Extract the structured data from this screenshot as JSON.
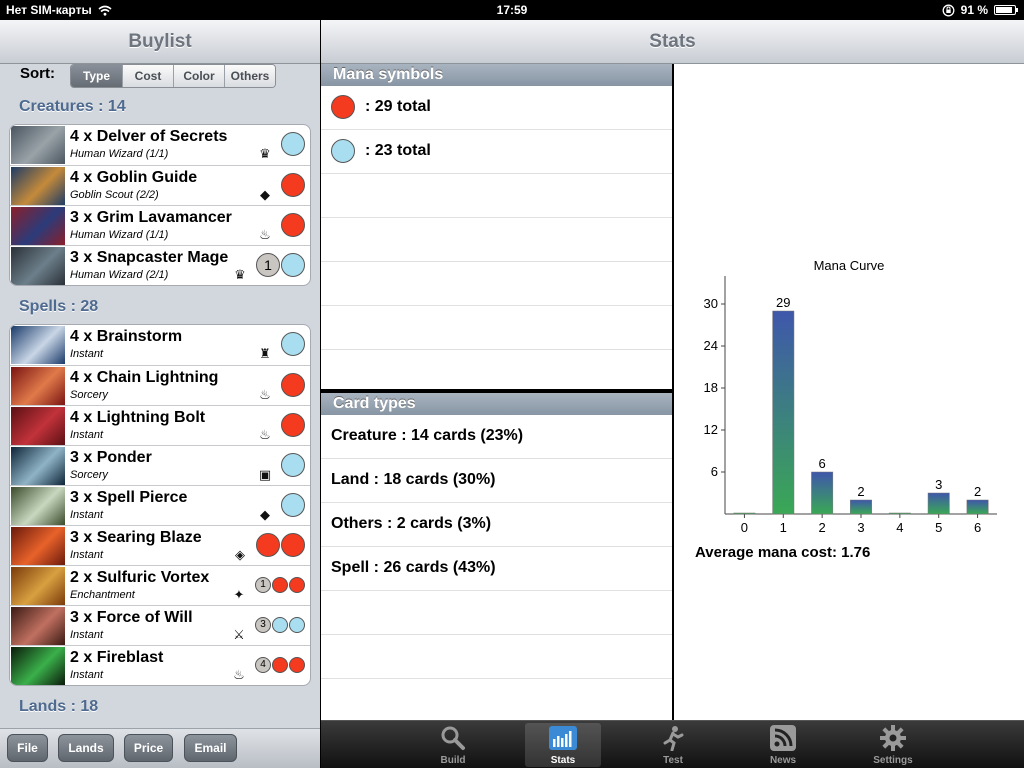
{
  "status": {
    "carrier": "Нет SIM-карты",
    "time": "17:59",
    "battery": "91 %",
    "battery_level": 0.91
  },
  "left": {
    "title": "Buylist",
    "sort_label": "Sort:",
    "sort_options": [
      "Type",
      "Cost",
      "Color",
      "Others"
    ],
    "sort_selected": "Type",
    "sections": [
      {
        "title": "Creatures : 14",
        "cards": [
          {
            "name": "4 x Delver of Secrets",
            "type": "Human Wizard (1/1)",
            "set_icon": "innistrad-set-icon",
            "mana": [
              "blue"
            ]
          },
          {
            "name": "4 x Goblin Guide",
            "type": "Goblin Scout (2/2)",
            "set_icon": "zendikar-set-icon",
            "mana": [
              "red"
            ]
          },
          {
            "name": "3 x Grim Lavamancer",
            "type": "Human Wizard (1/1)",
            "set_icon": "m12-set-icon",
            "mana": [
              "red"
            ]
          },
          {
            "name": "3 x Snapcaster Mage",
            "type": "Human Wizard (2/1)",
            "set_icon": "innistrad-set-icon",
            "mana": [
              "1",
              "blue"
            ]
          }
        ]
      },
      {
        "title": "Spells : 28",
        "cards": [
          {
            "name": "4 x Brainstorm",
            "type": "Instant",
            "set_icon": "iceage-set-icon",
            "mana": [
              "blue"
            ]
          },
          {
            "name": "4 x Chain Lightning",
            "type": "Sorcery",
            "set_icon": "m12-set-icon",
            "mana": [
              "red"
            ]
          },
          {
            "name": "4 x Lightning Bolt",
            "type": "Instant",
            "set_icon": "m12-set-icon",
            "mana": [
              "red"
            ]
          },
          {
            "name": "3 x Ponder",
            "type": "Sorcery",
            "set_icon": "m12b-set-icon",
            "mana": [
              "blue"
            ]
          },
          {
            "name": "3 x Spell Pierce",
            "type": "Instant",
            "set_icon": "zendikar-set-icon",
            "mana": [
              "blue"
            ]
          },
          {
            "name": "3 x Searing Blaze",
            "type": "Instant",
            "set_icon": "worldwake-set-icon",
            "mana": [
              "red",
              "red"
            ]
          },
          {
            "name": "2 x Sulfuric Vortex",
            "type": "Enchantment",
            "set_icon": "scourge-set-icon",
            "mana": [
              "1",
              "red",
              "red"
            ]
          },
          {
            "name": "3 x Force of Will",
            "type": "Instant",
            "set_icon": "alliances-set-icon",
            "mana": [
              "3",
              "blue",
              "blue"
            ]
          },
          {
            "name": "2 x Fireblast",
            "type": "Instant",
            "set_icon": "m12-set-icon",
            "mana": [
              "4",
              "red",
              "red"
            ]
          }
        ]
      },
      {
        "title": "Lands : 18",
        "cards": []
      }
    ],
    "buttons": [
      "File",
      "Lands",
      "Price",
      "Email"
    ]
  },
  "right": {
    "title": "Stats",
    "mana_symbols": {
      "header": "Mana symbols",
      "items": [
        {
          "color": "#f43b1f",
          "text": ": 29 total"
        },
        {
          "color": "#a9def0",
          "text": ": 23 total"
        }
      ]
    },
    "card_types": {
      "header": "Card types",
      "items": [
        "Creature : 14 cards (23%)",
        "Land : 18 cards (30%)",
        "Others : 2 cards (3%)",
        "Spell : 26 cards (43%)"
      ]
    },
    "average": "Average mana cost: 1.76"
  },
  "chart_data": {
    "type": "bar",
    "title": "Mana Curve",
    "categories": [
      "0",
      "1",
      "2",
      "3",
      "4",
      "5",
      "6"
    ],
    "values": [
      0,
      29,
      6,
      2,
      0,
      3,
      2
    ],
    "data_labels": [
      "",
      "29",
      "6",
      "2",
      "",
      "3",
      "2"
    ],
    "yticks": [
      6,
      12,
      18,
      24,
      30
    ],
    "ylim": [
      0,
      34
    ],
    "colors": {
      "top": "#3f57ab",
      "bottom": "#3aa855"
    },
    "grid": false,
    "legend": "none"
  },
  "tabs": [
    {
      "label": "Build",
      "icon": "search-icon",
      "active": false
    },
    {
      "label": "Stats",
      "icon": "bar-chart-icon",
      "active": true
    },
    {
      "label": "Test",
      "icon": "runner-icon",
      "active": false
    },
    {
      "label": "News",
      "icon": "rss-icon",
      "active": false
    },
    {
      "label": "Settings",
      "icon": "gear-icon",
      "active": false
    }
  ]
}
